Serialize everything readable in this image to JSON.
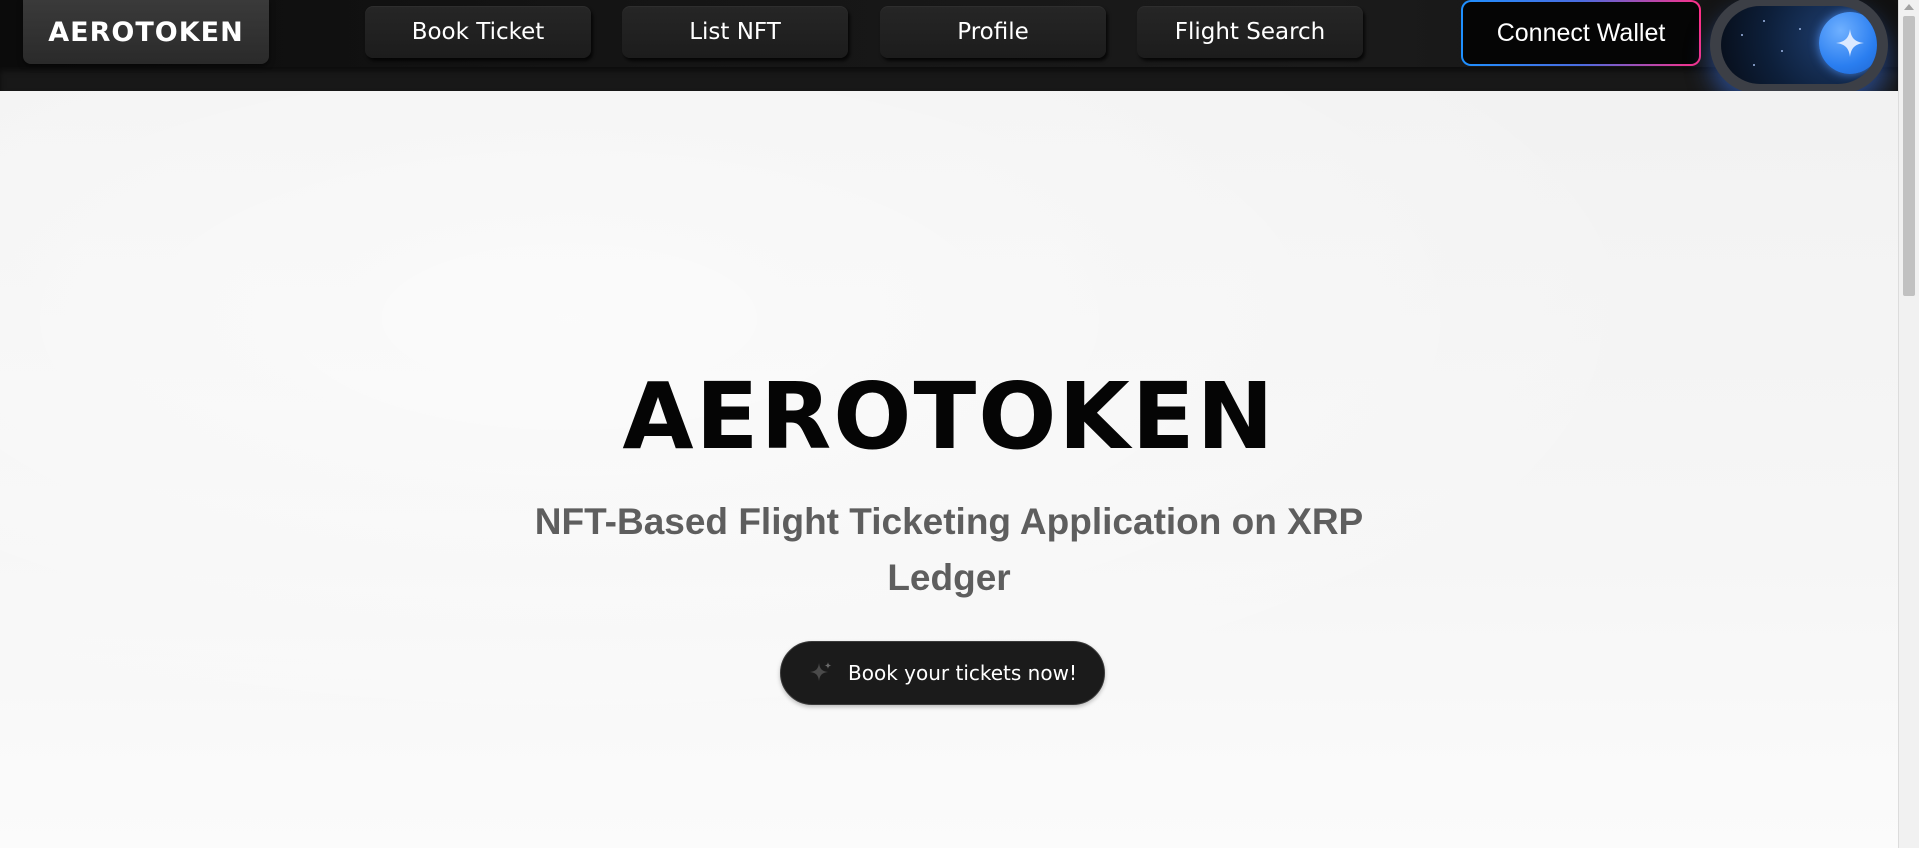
{
  "navbar": {
    "brand": "AEROTOKEN",
    "links": [
      {
        "label": "Book Ticket"
      },
      {
        "label": "List NFT"
      },
      {
        "label": "Profile"
      },
      {
        "label": "Flight Search"
      }
    ],
    "wallet_button": "Connect Wallet",
    "theme_toggle": {
      "state": "dark",
      "icon": "sparkle-icon"
    }
  },
  "hero": {
    "title": "AEROTOKEN",
    "subtitle": "NFT-Based Flight Ticketing Application on XRP Ledger",
    "cta_label": "Book your tickets now!",
    "cta_icon": "sparkle-icon"
  },
  "colors": {
    "navbar_bg": "#161616",
    "wallet_gradient_start": "#1e90ff",
    "wallet_gradient_end": "#ff2f88",
    "toggle_knob": "#2a7ef0",
    "subtitle_text": "#5e5e5e"
  }
}
